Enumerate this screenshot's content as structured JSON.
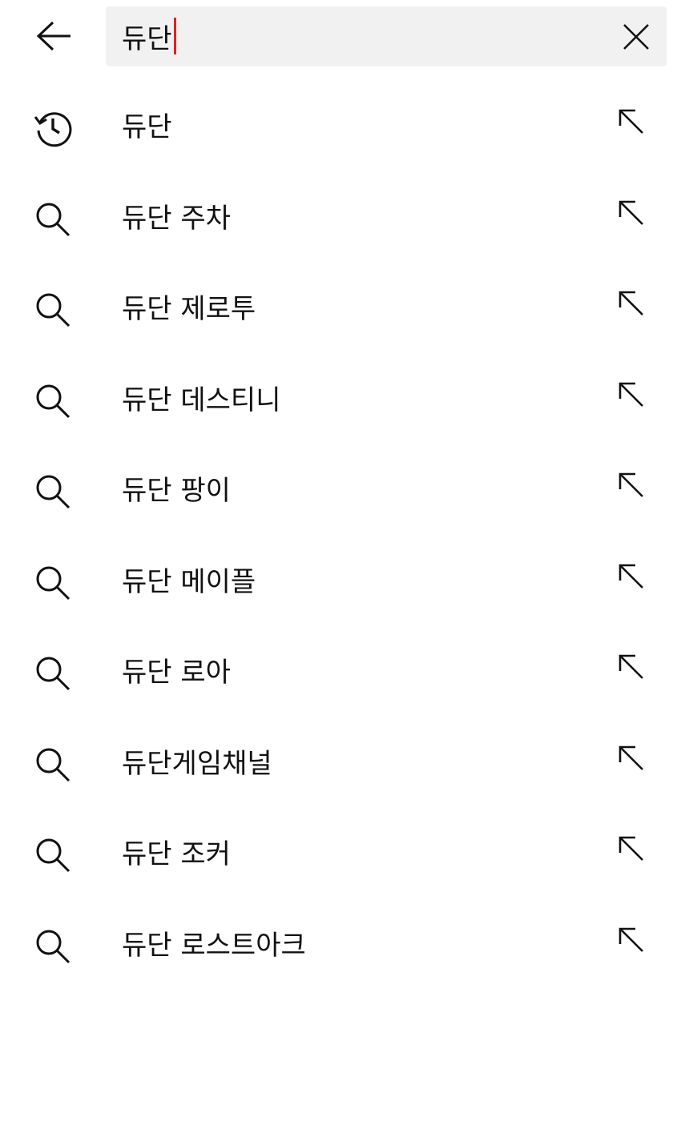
{
  "search": {
    "query": "듀단"
  },
  "suggestions": [
    {
      "label": "듀단",
      "icon": "history-icon"
    },
    {
      "label": "듀단 주차",
      "icon": "search-icon"
    },
    {
      "label": "듀단 제로투",
      "icon": "search-icon"
    },
    {
      "label": "듀단 데스티니",
      "icon": "search-icon"
    },
    {
      "label": "듀단 팡이",
      "icon": "search-icon"
    },
    {
      "label": "듀단 메이플",
      "icon": "search-icon"
    },
    {
      "label": "듀단 로아",
      "icon": "search-icon"
    },
    {
      "label": "듀단게임채널",
      "icon": "search-icon"
    },
    {
      "label": "듀단 조커",
      "icon": "search-icon"
    },
    {
      "label": "듀단 로스트아크",
      "icon": "search-icon"
    }
  ],
  "colors": {
    "caret": "#e02020",
    "search_background": "#f1f1f1",
    "text": "#111111"
  }
}
